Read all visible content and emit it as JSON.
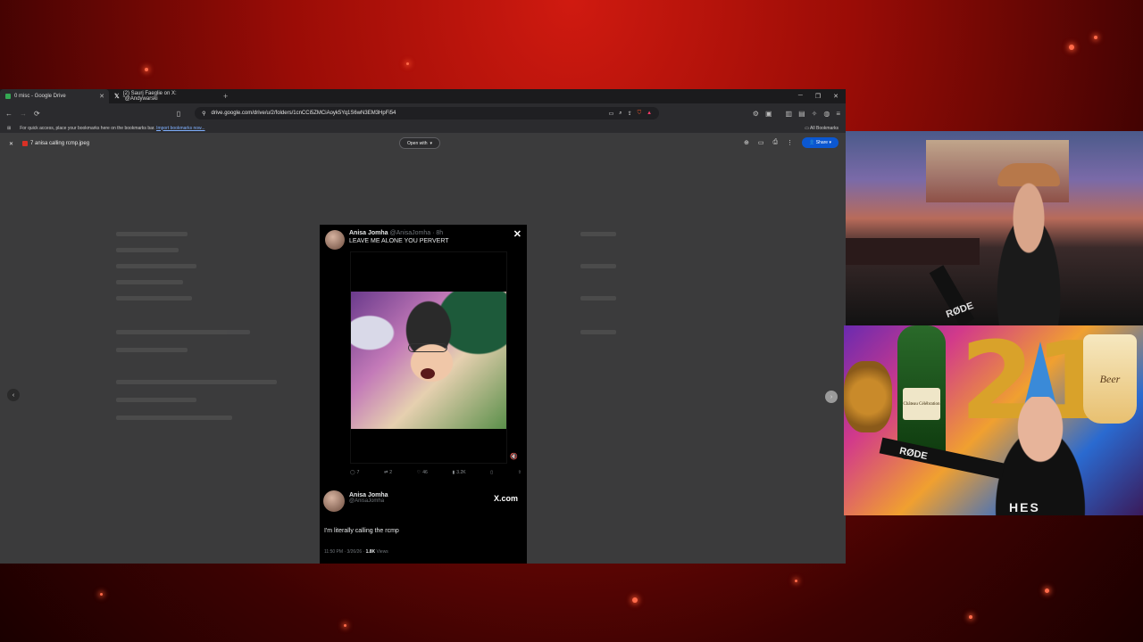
{
  "browser": {
    "tabs": [
      {
        "label": "0 misc - Google Drive",
        "favicon_color": "#34a853",
        "active": true
      },
      {
        "label": "(2) Saurj Faeglie on X: \"@Andywarski",
        "favicon_color": "#ffffff",
        "active": false
      }
    ],
    "newtab_icon": "plus-icon",
    "url": "drive.google.com/drive/u/2/folders/1cnCCi5ZMCiAoyk5Yq1S6wN3EM3HpFi54",
    "bookmarks_hint": "For quick access, place your bookmarks here on the bookmarks bar.",
    "bookmarks_link": "Import bookmarks now...",
    "all_bookmarks": "All Bookmarks"
  },
  "viewer": {
    "file_name": "7 anisa calling rcmp.jpeg",
    "open_with": "Open with",
    "share": "Share"
  },
  "tweet": {
    "name": "Anisa Jomha",
    "handle_time": "@AnisaJomha · 8h",
    "text": "LEAVE ME ALONE YOU PERVERT",
    "stats": {
      "replies": "7",
      "reposts": "2",
      "likes": "46",
      "views": "3.2K"
    },
    "embed_name": "Anisa Jomha",
    "embed_handle": "@AnisaJomha",
    "brand": "X.com",
    "quote": "I'm literally calling the rcmp",
    "time": "11:50 PM · 3/26/26 · ",
    "views_count": "1.8K",
    "views_label": " Views"
  },
  "webcams": {
    "top_mic_brand": "RØDE",
    "bottom_mic_brand": "RØDE",
    "bottle_label": "Château Célébration",
    "balloon_number": "21",
    "cup_text": "Beer",
    "shirt_text": "HES"
  }
}
